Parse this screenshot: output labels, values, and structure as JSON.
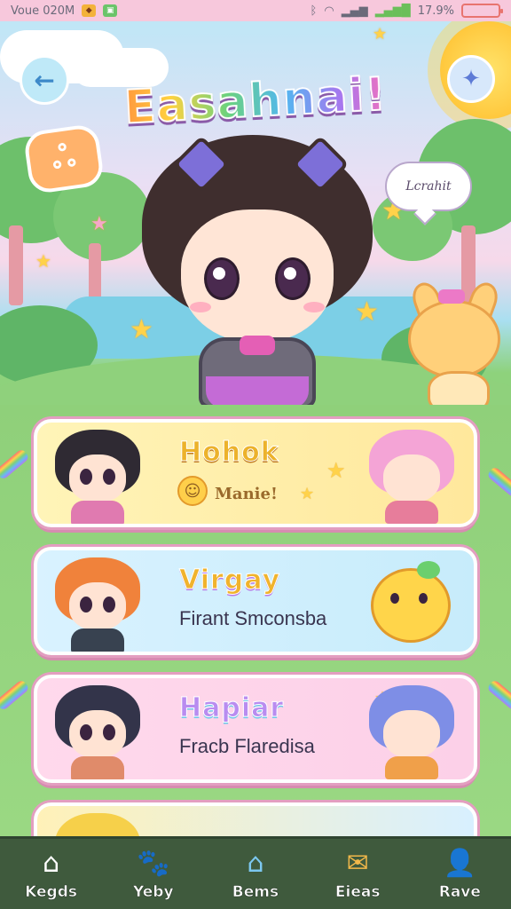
{
  "status_bar": {
    "left_text": "Voue 020M",
    "right_text": "17.9%"
  },
  "header": {
    "title": "Easahnai!",
    "back_icon": "arrow-left-icon",
    "settings_icon": "butterfly-icon",
    "speech_text": "Lcrahit"
  },
  "cards": [
    {
      "title": "Hohok",
      "subtitle": "Manie!"
    },
    {
      "title": "Virgay",
      "subtitle": "Firant Smconsba"
    },
    {
      "title": "Hapiar",
      "subtitle": "Fracb Flaredisa"
    },
    {
      "title": "",
      "subtitle": ""
    }
  ],
  "bottom_nav": [
    {
      "label": "Kegds",
      "icon": "home-icon"
    },
    {
      "label": "Yeby",
      "icon": "cat-icon"
    },
    {
      "label": "Bems",
      "icon": "house-icon"
    },
    {
      "label": "Eieas",
      "icon": "envelope-icon"
    },
    {
      "label": "Rave",
      "icon": "person-icon"
    }
  ],
  "colors": {
    "status_bar": "#f7c8dc",
    "nav_bg": "#3f5a3d",
    "card_border": "#e39ec0"
  }
}
